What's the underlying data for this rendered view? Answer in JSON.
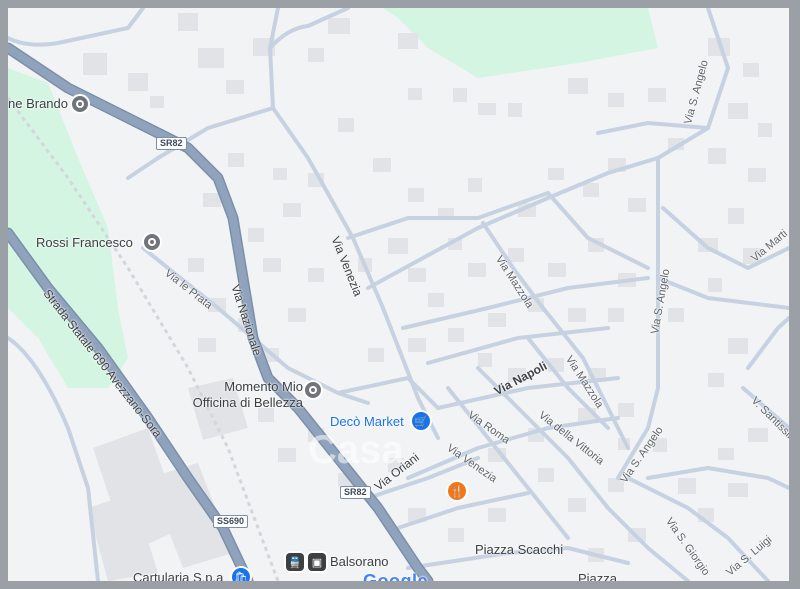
{
  "map": {
    "pois": {
      "brando": "ne Brando",
      "rossi": "Rossi Francesco",
      "momento_line1": "Momento Mio",
      "momento_line2": "Officina di Bellezza",
      "deco": "Decò Market",
      "balsorano": "Balsorano",
      "cartularia": "Cartularia S.p.a",
      "piazza_scacchi": "Piazza Scacchi",
      "piazza": "Piazza"
    },
    "streets": {
      "via_nazionale": "Via Nazionale",
      "via_venezia": "Via Venezia",
      "via_venezia_2": "Via Venezia",
      "via_le_prata": "Via le Prata",
      "via_mazzola": "Via Mazzola",
      "via_mazzola_2": "Via Mazzola",
      "via_s_angelo_1": "Via S. Angelo",
      "via_s_angelo_2": "Via S. Angelo",
      "via_s_angelo_3": "Via S. Angelo",
      "via_martiri": "Via Marti",
      "via_napoli": "Via Napoli",
      "via_roma": "Via Roma",
      "via_della_vittoria": "Via della Vittoria",
      "via_oriani": "Via Oriani",
      "via_santissima": "V. Santissim",
      "via_s_giorgio": "Via S. Giorgio",
      "via_s_luigi": "Via S. Luigi",
      "strada_statale": "Strada Statale 690 Avezzano-Sora"
    },
    "shields": {
      "sr82_top": "SR82",
      "sr82_bottom": "SR82",
      "ss690": "SS690"
    },
    "watermark": "Casa",
    "logo": "Google",
    "colors": {
      "background": "#f1f3f4",
      "green_area": "#d5f5e3",
      "main_road": "#8fa3bd",
      "main_road_edge": "#7b8fa8",
      "minor_road": "#c6d2e1",
      "building": "#e1e3e6",
      "shop_pin": "#1a73e8",
      "food_pin": "#f2771a",
      "poi_pin": "#70757a"
    }
  }
}
